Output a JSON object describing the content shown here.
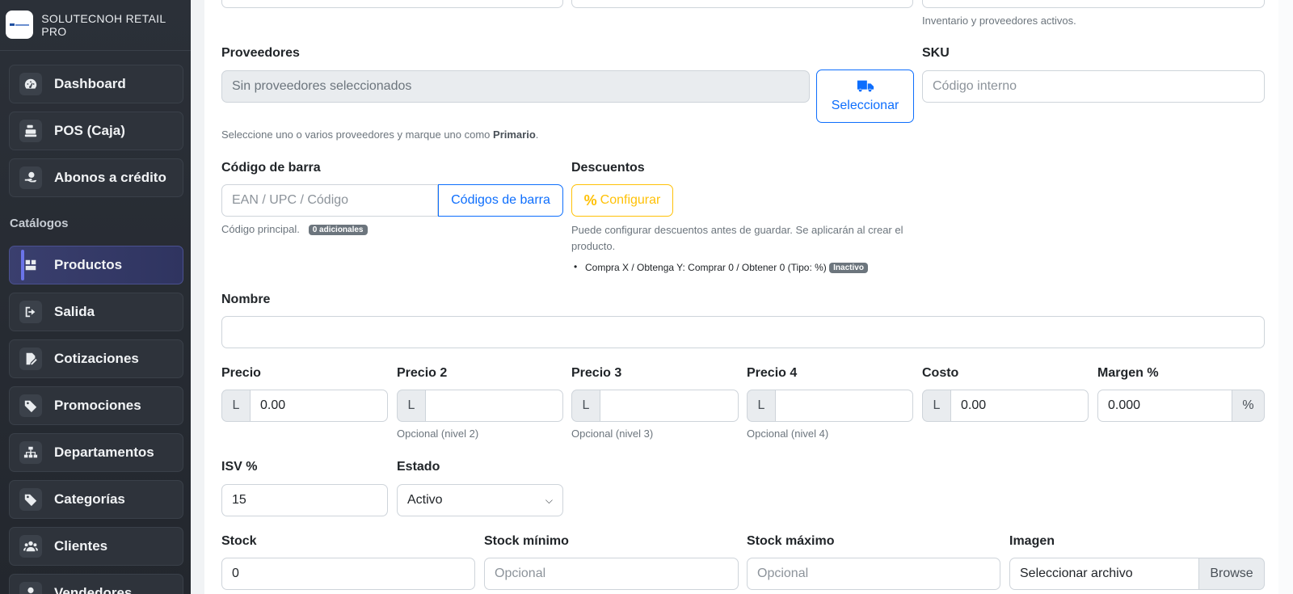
{
  "app": {
    "brand_name": "SOLUTECNOH RETAIL PRO"
  },
  "sidebar": {
    "items_top": [
      {
        "label": "Dashboard",
        "icon": "gauge-icon"
      },
      {
        "label": "POS (Caja)",
        "icon": "cash-register-icon"
      },
      {
        "label": "Abonos a crédito",
        "icon": "hand-dollar-icon"
      }
    ],
    "section_label": "Catálogos",
    "items_catalog": [
      {
        "label": "Productos",
        "icon": "box-icon",
        "active": true
      },
      {
        "label": "Salida",
        "icon": "sign-out-icon"
      },
      {
        "label": "Cotizaciones",
        "icon": "file-pen-icon"
      },
      {
        "label": "Promociones",
        "icon": "tags-icon"
      },
      {
        "label": "Departamentos",
        "icon": "sitemap-icon"
      },
      {
        "label": "Categorías",
        "icon": "tags-icon"
      },
      {
        "label": "Clientes",
        "icon": "users-icon"
      },
      {
        "label": "Vendedores",
        "icon": "user-icon"
      }
    ]
  },
  "form": {
    "top_help": "Inventario y proveedores activos.",
    "proveedores": {
      "label": "Proveedores",
      "value": "Sin proveedores seleccionados",
      "button": "Seleccionar",
      "help_prefix": "Seleccione uno o varios proveedores y marque uno como ",
      "help_strong": "Primario",
      "help_suffix": "."
    },
    "sku": {
      "label": "SKU",
      "placeholder": "Código interno"
    },
    "barcode": {
      "label": "Código de barra",
      "placeholder": "EAN / UPC / Código",
      "button": "Códigos de barra",
      "help": "Código principal.",
      "badge": "0 adicionales"
    },
    "descuentos": {
      "label": "Descuentos",
      "button": "Configurar",
      "help": "Puede configurar descuentos antes de guardar. Se aplicarán al crear el producto.",
      "item": "Compra X / Obtenga Y: Comprar 0 / Obtener 0 (Tipo: %)",
      "item_badge": "Inactivo"
    },
    "nombre": {
      "label": "Nombre",
      "value": ""
    },
    "precios": [
      {
        "label": "Precio",
        "currency": "L",
        "value": "0.00",
        "help": ""
      },
      {
        "label": "Precio 2",
        "currency": "L",
        "value": "",
        "help": "Opcional (nivel 2)"
      },
      {
        "label": "Precio 3",
        "currency": "L",
        "value": "",
        "help": "Opcional (nivel 3)"
      },
      {
        "label": "Precio 4",
        "currency": "L",
        "value": "",
        "help": "Opcional (nivel 4)"
      },
      {
        "label": "Costo",
        "currency": "L",
        "value": "0.00",
        "help": ""
      }
    ],
    "margen": {
      "label": "Margen %",
      "value": "0.000",
      "suffix": "%"
    },
    "isv": {
      "label": "ISV %",
      "value": "15"
    },
    "estado": {
      "label": "Estado",
      "value": "Activo"
    },
    "stock": {
      "label": "Stock",
      "value": "0"
    },
    "stock_min": {
      "label": "Stock mínimo",
      "placeholder": "Opcional"
    },
    "stock_max": {
      "label": "Stock máximo",
      "placeholder": "Opcional"
    },
    "imagen": {
      "label": "Imagen",
      "file_text": "Seleccionar archivo",
      "browse": "Browse"
    }
  },
  "colors": {
    "primary": "#0d6efd",
    "warning": "#ffc107",
    "sidebar_bg": "#2b3038",
    "active": "#3a3f6e"
  }
}
